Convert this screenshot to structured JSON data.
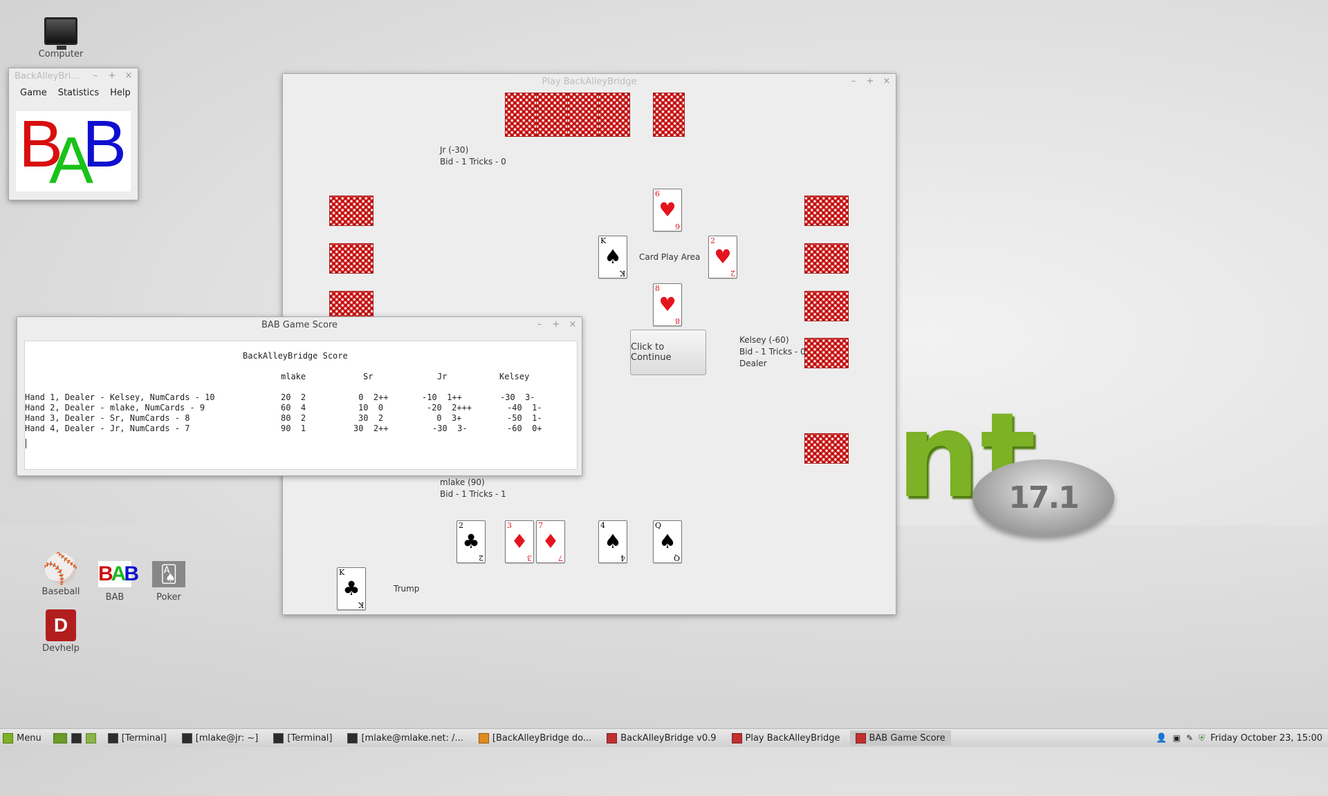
{
  "desktop": {
    "icons": [
      {
        "label": "Computer"
      },
      {
        "label": "Baseball"
      },
      {
        "label": "BAB"
      },
      {
        "label": "Poker"
      },
      {
        "label": "Devhelp"
      }
    ],
    "mint_badge_text": "17.1"
  },
  "bab_main_window": {
    "title": "BackAlleyBri...",
    "menu": [
      "Game",
      "Statistics",
      "Help"
    ],
    "logo_letters": [
      "B",
      "A",
      "B"
    ]
  },
  "play_window": {
    "title": "Play BackAlleyBridge",
    "players": {
      "north": {
        "name": "Jr (-30)",
        "status": "Bid - 1  Tricks - 0"
      },
      "east": {
        "name": "Kelsey (-60)",
        "status": "Bid - 1  Tricks - 0",
        "role": "Dealer"
      },
      "south": {
        "name": "mlake (90)",
        "status": "Bid - 1  Tricks - 1"
      }
    },
    "center_label": "Card Play Area",
    "continue_button": "Click to Continue",
    "trump_label": "Trump",
    "played_cards": [
      {
        "rank": "6",
        "suit": "♥",
        "color": "red"
      },
      {
        "rank": "K",
        "suit": "♠",
        "color": "black"
      },
      {
        "rank": "2",
        "suit": "♥",
        "color": "red"
      },
      {
        "rank": "8",
        "suit": "♥",
        "color": "red"
      }
    ],
    "hand_cards": [
      {
        "rank": "2",
        "suit": "♣",
        "color": "black"
      },
      {
        "rank": "3",
        "suit": "♦",
        "color": "red"
      },
      {
        "rank": "7",
        "suit": "♦",
        "color": "red"
      },
      {
        "rank": "4",
        "suit": "♠",
        "color": "black"
      },
      {
        "rank": "Q",
        "suit": "♠",
        "color": "black"
      }
    ],
    "trump_card": {
      "rank": "K",
      "suit": "♣",
      "color": "black"
    }
  },
  "score_window": {
    "title": "BAB Game Score",
    "heading": "BackAlleyBridge Score",
    "columns": [
      "mlake",
      "Sr",
      "Jr",
      "Kelsey"
    ],
    "rows": [
      {
        "hand": "Hand 1, Dealer - Kelsey, NumCards - 10",
        "scores": [
          "20  2",
          " 0  2++",
          "-10  1++",
          "-30  3-"
        ]
      },
      {
        "hand": "Hand 2, Dealer - mlake, NumCards - 9",
        "scores": [
          "60  4",
          "10  0",
          "-20  2+++",
          "-40  1-"
        ]
      },
      {
        "hand": "Hand 3, Dealer - Sr, NumCards - 8",
        "scores": [
          "80  2",
          "30  2",
          " 0  3+",
          "-50  1-"
        ]
      },
      {
        "hand": "Hand 4, Dealer - Jr, NumCards - 7",
        "scores": [
          "90  1",
          "30  2++",
          "-30  3-",
          "-60  0+"
        ]
      }
    ]
  },
  "taskbar": {
    "menu_label": "Menu",
    "items": [
      "[Terminal]",
      "[mlake@jr: ~]",
      "[Terminal]",
      "[mlake@mlake.net: /...",
      "[BackAlleyBridge do...",
      "BackAlleyBridge v0.9",
      "Play BackAlleyBridge",
      "BAB Game Score"
    ],
    "clock": "Friday October 23, 15:00"
  }
}
